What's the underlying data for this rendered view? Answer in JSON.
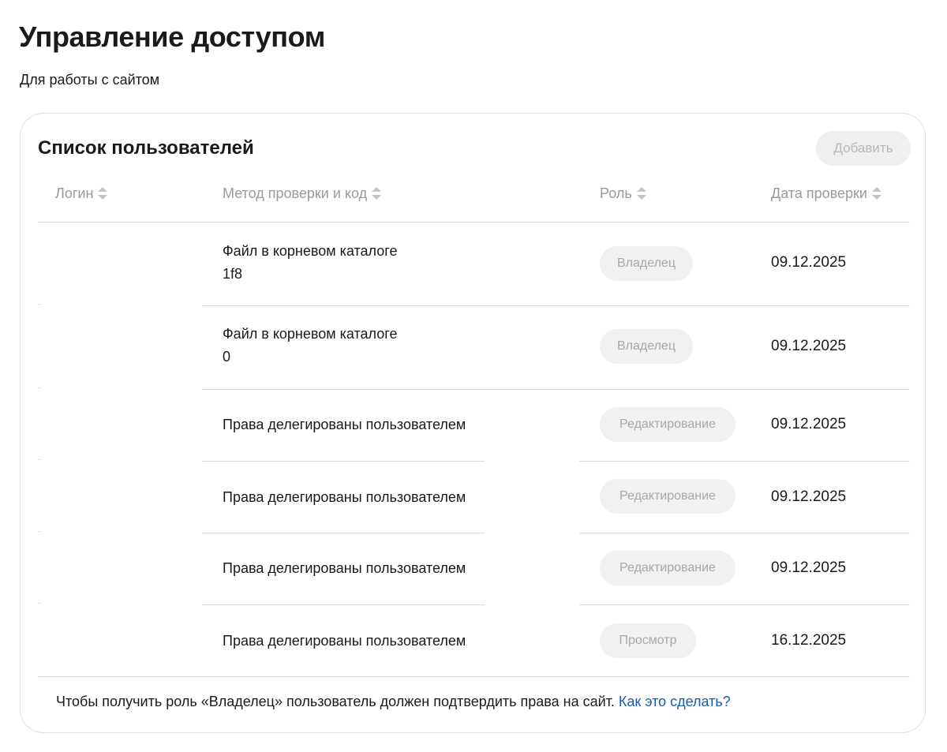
{
  "page": {
    "title": "Управление доступом",
    "subtitle": "Для работы с сайтом"
  },
  "card": {
    "title": "Список пользователей",
    "add_button": "Добавить"
  },
  "table": {
    "columns": [
      {
        "label": "Логин",
        "icon": "sort-icon"
      },
      {
        "label": "Метод проверки и код",
        "icon": "sort-icon"
      },
      {
        "label": "Роль",
        "icon": "sort-icon"
      },
      {
        "label": "Дата проверки",
        "icon": "sort-icon"
      }
    ],
    "rows": [
      {
        "method": "Файл в корневом каталоге",
        "code": "1f8",
        "role": "Владелец",
        "date": "09.12.2025"
      },
      {
        "method": "Файл в корневом каталоге",
        "code": "0",
        "role": "Владелец",
        "date": "09.12.2025"
      },
      {
        "method": "Права делегированы пользователем",
        "code": "",
        "role": "Редактирование",
        "date": "09.12.2025"
      },
      {
        "method": "Права делегированы пользователем",
        "code": "",
        "role": "Редактирование",
        "date": "09.12.2025"
      },
      {
        "method": "Права делегированы пользователем",
        "code": "",
        "role": "Редактирование",
        "date": "09.12.2025"
      },
      {
        "method": "Права делегированы пользователем",
        "code": "",
        "role": "Просмотр",
        "date": "16.12.2025"
      }
    ]
  },
  "footer": {
    "note": "Чтобы получить роль «Владелец» пользователь должен подтвердить права на сайт. ",
    "link": "Как это сделать?"
  },
  "colors": {
    "link": "#1b5bb0",
    "muted_text": "#9a9a9a",
    "badge_bg": "#f1f1f1"
  }
}
